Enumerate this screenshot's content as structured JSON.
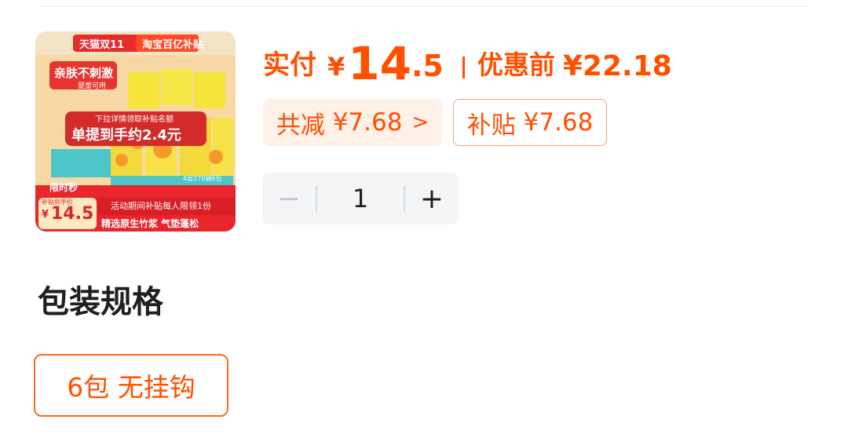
{
  "product_image": {
    "badge_left": "天猫双11",
    "badge_right": "淘宝百亿补贴",
    "tagline": "亲肤不刺激",
    "tagline_sub": "婴童可用",
    "hint": "下拉详情领取补贴名额",
    "promo": "单提到手约2.4元",
    "spec_tag": "4层270抽6包",
    "flash": "限时秒",
    "price_caption": "补贴到手价",
    "price_yen": "¥",
    "price": "14.5",
    "activity": "活动期间补贴每人限领1份",
    "features": "精选原生竹浆 气垫蓬松"
  },
  "price": {
    "paid_label": "实付",
    "currency": "¥",
    "integer": "14",
    "decimal": ".5",
    "original_label": "优惠前",
    "original_value": "¥22.18"
  },
  "discounts": {
    "total_label": "共减",
    "total_value": "¥7.68",
    "total_arrow": ">",
    "subsidy_label": "补贴",
    "subsidy_value": "¥7.68"
  },
  "quantity": {
    "minus": "−",
    "value": "1",
    "plus": "+"
  },
  "spec": {
    "title": "包装规格",
    "selected_option": "6包 无挂钩"
  },
  "colors": {
    "accent": "#ff5000",
    "chip_bg": "#fff0e8",
    "stepper_bg": "#f4f5f7",
    "text": "#1f1f1f"
  }
}
